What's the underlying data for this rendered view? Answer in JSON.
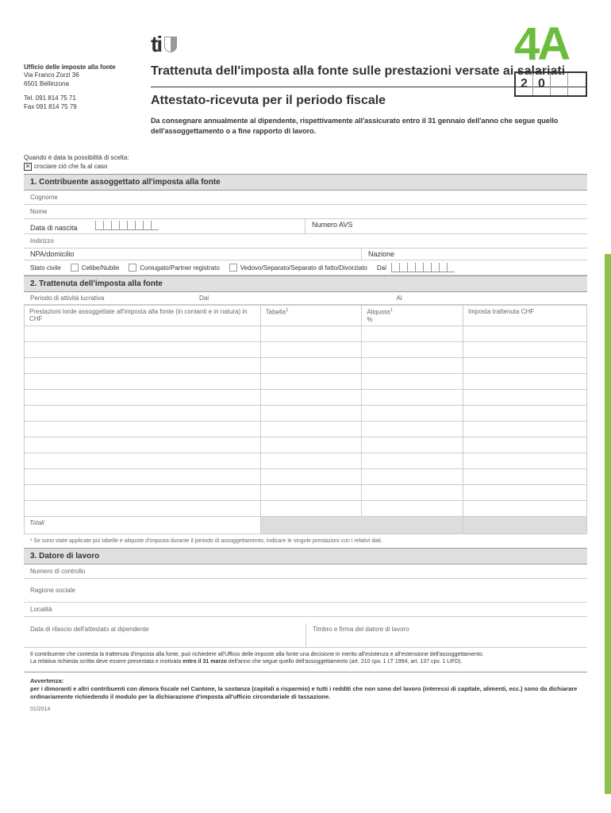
{
  "office": {
    "name": "Ufficio delle imposte alla fonte",
    "address1": "Via Franco Zorzi 36",
    "address2": "6501 Bellinzona",
    "tel": "Tel. 091 814 75 71",
    "fax": "Fax 091 814 75 79"
  },
  "header": {
    "logo_text": "ti",
    "form_code": "4A",
    "title1": "Trattenuta dell'imposta alla fonte sulle prestazioni versate ai salariati",
    "title2": "Attestato-ricevuta per il periodo fiscale",
    "year_prefix_1": "2",
    "year_prefix_2": "0",
    "subtitle": "Da consegnare annualmente al dipendente, rispettivamente all'assicurato entro il 31 gennaio dell'anno che segue quello dell'assoggettamento o a fine rapporto di lavoro.",
    "instruction1": "Quando è data la possibilità di scelta:",
    "instruction2": "crociare ciò che fa al caso"
  },
  "section1": {
    "title": "1.   Contribuente assoggettato all'imposta alla fonte",
    "cognome": "Cognome",
    "nome": "Nome",
    "data_nascita": "Data di nascita",
    "numero_avs": "Numero AVS",
    "indirizzo": "Indirizzo",
    "npa": "NPA/domicilio",
    "nazione": "Nazione",
    "stato_civile": "Stato civile",
    "celibe": "Celibe/Nubile",
    "coniugato": "Coniugato/Partner registrato",
    "vedovo": "Vedovo/Separato/Separato di fatto/Divorziato",
    "dal": "Dal"
  },
  "section2": {
    "title": "2.   Trattenuta dell'imposta alla fonte",
    "periodo": "Periodo di attività lucrativa",
    "dal": "Dal",
    "al": "Al",
    "col1": "Prestazioni lorde assoggettate all'imposta alla fonte (in contanti e in natura) in CHF",
    "col2": "Tabella",
    "col3": "Aliquota",
    "col3b": "%",
    "col4": "Imposta trattenuta CHF",
    "totali": "Totali",
    "footnote": "¹ Se sono state applicate più tabelle e aliquote d'imposta durante il periodo di assoggettamento, indicare le singole prestazioni con i relativi dati."
  },
  "section3": {
    "title": "3.   Datore di lavoro",
    "numero": "Numero di controllo",
    "ragione": "Ragione sociale",
    "localita": "Località",
    "data_rilascio": "Data di rilascio dell'attestato al dipendente",
    "timbro": "Timbro e firma del datore di lavoro"
  },
  "legal": {
    "text1": "Il contribuente che contesta la trattenuta d'imposta alla fonte, può richiedere all'Ufficio delle imposte alla fonte una decisione in merito all'esistenza e all'estensione dell'assoggettamento.",
    "text2a": "La relativa richiesta scritta deve essere presentata e motivata ",
    "text2b": "entro il 31 marzo",
    "text2c": " dell'anno che segue quello dell'assoggettamento (art. 210 cpv. 1 LT 1994, art. 137 cpv. 1 LIFD)."
  },
  "avvertenza": {
    "title": "Avvertenza:",
    "text": "per i dimoranti e altri contribuenti con dimora fiscale nel Cantone, la sostanza (capitali a risparmio) e tutti i redditi che non sono del lavoro (interessi di capitale, alimenti, ecc.) sono da dichiarare ordinariamente richiedendo il modulo per la dichiarazione d'imposta all'ufficio circondariale di tassazione."
  },
  "doc_date": "01/2014"
}
